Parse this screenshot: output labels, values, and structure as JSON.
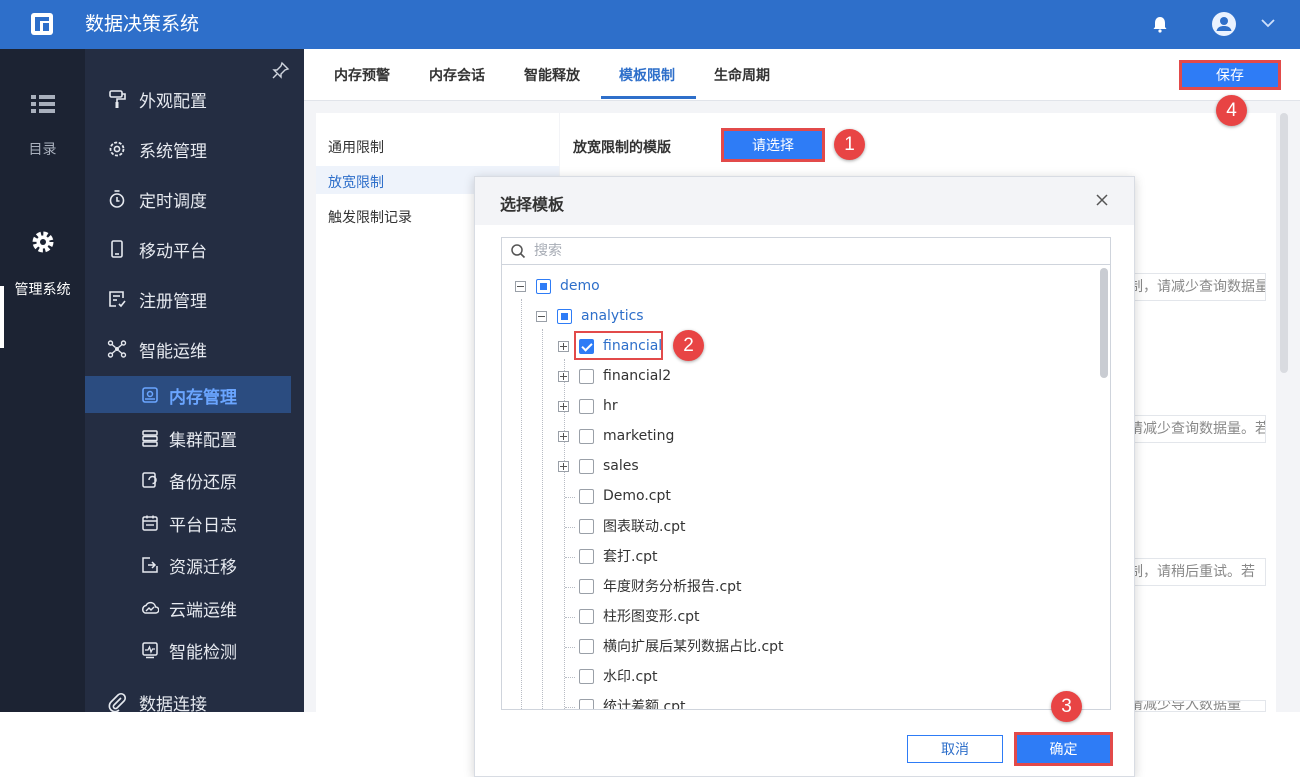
{
  "app": {
    "title": "数据决策系统"
  },
  "rail": {
    "items": [
      {
        "label": "目录",
        "icon": "list-icon"
      },
      {
        "label": "管理系统",
        "icon": "gear-icon"
      }
    ]
  },
  "sidebar": {
    "items": [
      {
        "label": "外观配置",
        "icon": "paint-roller-icon"
      },
      {
        "label": "系统管理",
        "icon": "gear-icon"
      },
      {
        "label": "定时调度",
        "icon": "stopwatch-icon"
      },
      {
        "label": "移动平台",
        "icon": "mobile-icon"
      },
      {
        "label": "注册管理",
        "icon": "register-icon"
      },
      {
        "label": "智能运维",
        "icon": "network-icon"
      }
    ],
    "sub_items": [
      {
        "label": "内存管理",
        "icon": "memory-icon"
      },
      {
        "label": "集群配置",
        "icon": "cluster-icon"
      },
      {
        "label": "备份还原",
        "icon": "backup-icon"
      },
      {
        "label": "平台日志",
        "icon": "calendar-log-icon"
      },
      {
        "label": "资源迁移",
        "icon": "migrate-icon"
      },
      {
        "label": "云端运维",
        "icon": "cloud-chart-icon"
      },
      {
        "label": "智能检测",
        "icon": "monitor-icon"
      }
    ],
    "bottom_item": {
      "label": "数据连接",
      "icon": "paperclip-icon"
    }
  },
  "tabs": [
    "内存预警",
    "内存会话",
    "智能释放",
    "模板限制",
    "生命周期"
  ],
  "save_label": "保存",
  "leftnav": [
    "通用限制",
    "放宽限制",
    "触发限制记录"
  ],
  "form": {
    "template_label": "放宽限制的模版",
    "select_button": "请选择"
  },
  "background_hints": [
    "制，请减少查询数据量",
    "请减少查询数据量。若",
    "制，请稍后重试。若",
    "请减少导入数据量"
  ],
  "modal": {
    "title": "选择模板",
    "search_placeholder": "搜索",
    "tree": {
      "root": "demo",
      "child": "analytics",
      "folders": [
        "financial",
        "financial2",
        "hr",
        "marketing",
        "sales"
      ],
      "files": [
        "Demo.cpt",
        "图表联动.cpt",
        "套打.cpt",
        "年度财务分析报告.cpt",
        "柱形图变形.cpt",
        "横向扩展后某列数据占比.cpt",
        "水印.cpt",
        "统计差额.cpt"
      ],
      "checked": "financial"
    },
    "cancel": "取消",
    "confirm": "确定"
  },
  "badges": [
    "1",
    "2",
    "3",
    "4"
  ],
  "colors": {
    "topbar": "#2e6fca",
    "accent": "#2e7cf6",
    "sidebar": "#242d42",
    "highlight": "#e24a4a"
  }
}
